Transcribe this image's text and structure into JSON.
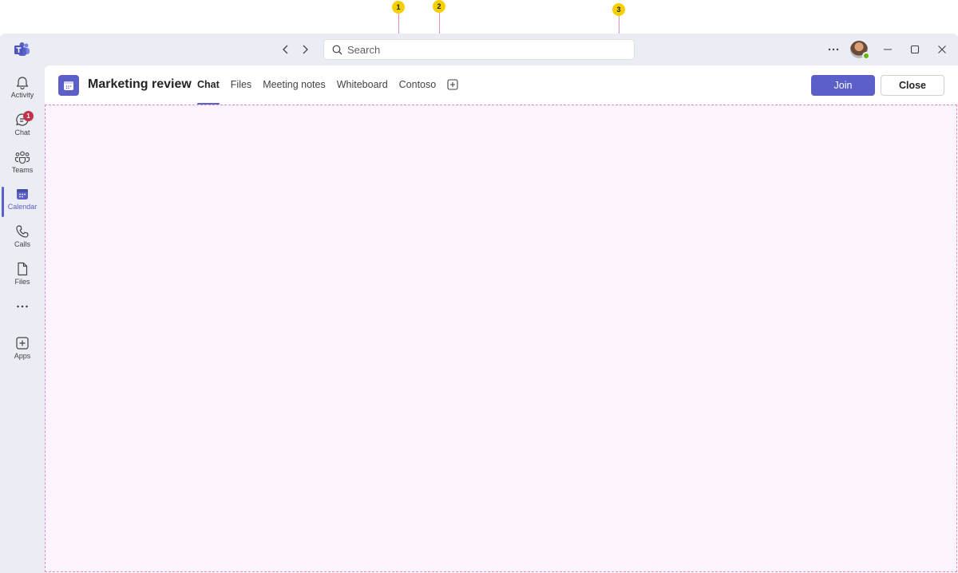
{
  "callouts": [
    "1",
    "2",
    "3"
  ],
  "search": {
    "placeholder": "Search"
  },
  "rail": {
    "items": [
      {
        "label": "Activity",
        "icon": "bell-icon"
      },
      {
        "label": "Chat",
        "icon": "chat-icon",
        "badge": "1"
      },
      {
        "label": "Teams",
        "icon": "teams-icon"
      },
      {
        "label": "Calendar",
        "icon": "calendar-icon",
        "active": true
      },
      {
        "label": "Calls",
        "icon": "phone-icon"
      },
      {
        "label": "Files",
        "icon": "file-icon"
      },
      {
        "label": "Apps",
        "icon": "add-apps-icon"
      }
    ]
  },
  "meeting": {
    "title": "Marketing review",
    "tabs": [
      "Chat",
      "Files",
      "Meeting notes",
      "Whiteboard",
      "Contoso"
    ],
    "active_tab": "Chat",
    "join_label": "Join",
    "close_label": "Close"
  },
  "colors": {
    "accent": "#5b5fc7",
    "badge": "#c4314b",
    "callout": "#f5d000",
    "callout_line": "#e58ac7",
    "content_bg": "#fdf4fd"
  }
}
